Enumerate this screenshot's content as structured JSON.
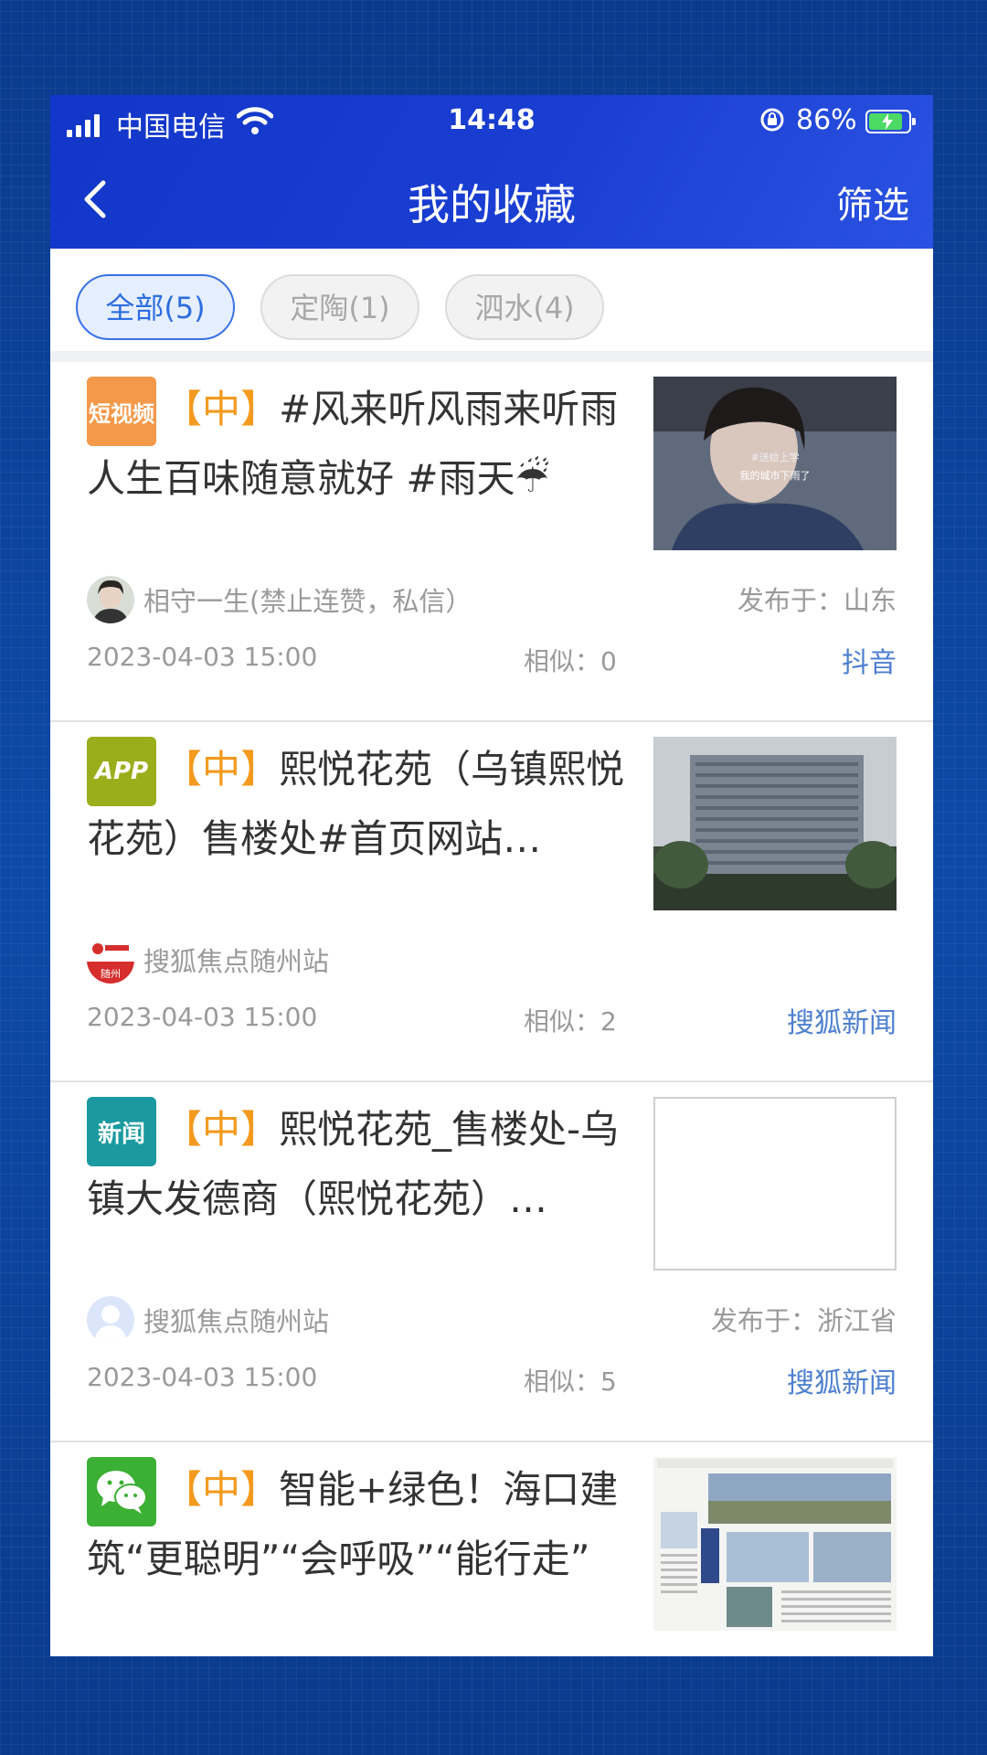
{
  "status_bar": {
    "carrier": "中国电信",
    "time": "14:48",
    "battery": "86%"
  },
  "header": {
    "title": "我的收藏",
    "filter_label": "筛选"
  },
  "tabs": [
    {
      "label": "全部(5)",
      "active": true
    },
    {
      "label": "定陶(1)",
      "active": false
    },
    {
      "label": "泗水(4)",
      "active": false
    }
  ],
  "items": [
    {
      "badge": "短视频",
      "badge_color": "#f4994a",
      "level": "【中】",
      "title": "#风来听风雨来听雨人生百味随意就好 #雨天☔",
      "author": "相守一生(禁止连赞，私信）",
      "published": "发布于：山东",
      "date": "2023-04-03 15:00",
      "similar": "相似：0",
      "source": "抖音",
      "thumb_text_1": "#送给上学",
      "thumb_text_2": "我的城市下雨了"
    },
    {
      "badge": "APP",
      "badge_color": "#9aae1c",
      "level": "【中】",
      "title": "熙悦花苑（乌镇熙悦花苑）售楼处#首页网站…",
      "author": "搜狐焦点随州站",
      "avatar_text": "随州",
      "published": "",
      "date": "2023-04-03 15:00",
      "similar": "相似：2",
      "source": "搜狐新闻"
    },
    {
      "badge": "新闻",
      "badge_color": "#1a9aa0",
      "level": "【中】",
      "title": "熙悦花苑_售楼处-乌镇大发德商（熙悦花苑）…",
      "author": "搜狐焦点随州站",
      "published": "发布于：浙江省",
      "date": "2023-04-03 15:00",
      "similar": "相似：5",
      "source": "搜狐新闻"
    },
    {
      "badge": "wechat",
      "badge_color": "#3cb034",
      "level": "【中】",
      "title": "智能+绿色！海口建筑“更聪明”“会呼吸”“能行走”",
      "author": "",
      "published": "",
      "date": "",
      "similar": "",
      "source": ""
    }
  ]
}
